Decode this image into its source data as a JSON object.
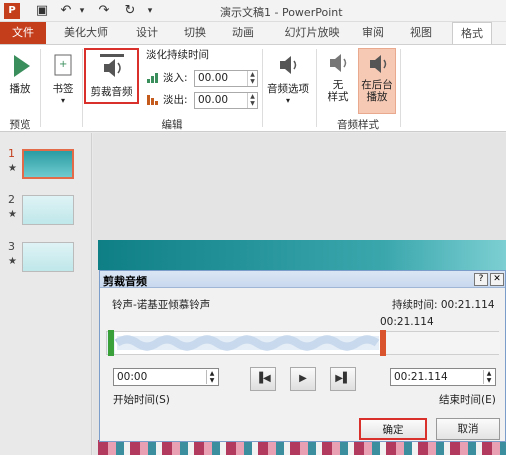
{
  "titlebar": {
    "title": "演示文稿1 - PowerPoint",
    "qat_icons": [
      "powerpoint-logo-icon",
      "save-icon",
      "undo-icon",
      "redo-icon",
      "repeat-icon"
    ]
  },
  "tabs": [
    "文件",
    "美化大师",
    "设计",
    "切换",
    "动画",
    "幻灯片放映",
    "审阅",
    "视图",
    "格式"
  ],
  "ribbon": {
    "preview": {
      "play_label": "播放",
      "group_label": "预览"
    },
    "bookmark_label": "书签",
    "edit": {
      "trim_label": "剪裁音频",
      "fade_title": "淡化持续时间",
      "fade_in_label": "淡入:",
      "fade_in_value": "00.00",
      "fade_out_label": "淡出:",
      "fade_out_value": "00.00",
      "group_label": "编辑"
    },
    "audio_options_label": "音频选项",
    "styles": {
      "no_style_label": "无\n样式",
      "play_bg_label": "在后台\n播放",
      "group_label": "音频样式"
    }
  },
  "slides": [
    {
      "num": "1",
      "star": "★"
    },
    {
      "num": "2",
      "star": "★"
    },
    {
      "num": "3",
      "star": "★"
    }
  ],
  "dialog": {
    "title": "剪裁音频",
    "help_label": "?",
    "close_label": "✕",
    "file_name": "铃声-诺基亚倾慕铃声",
    "duration_label": "持续时间: 00:21.114",
    "end_marker": "00:21.114",
    "start_time_value": "00:00",
    "start_time_label": "开始时间(S)",
    "end_time_value": "00:21.114",
    "end_time_label": "结束时间(E)",
    "ok_label": "确定",
    "cancel_label": "取消"
  },
  "colors": {
    "accent": "#c43e1c",
    "highlight": "#d9302c",
    "teal": "#0f7f86"
  }
}
